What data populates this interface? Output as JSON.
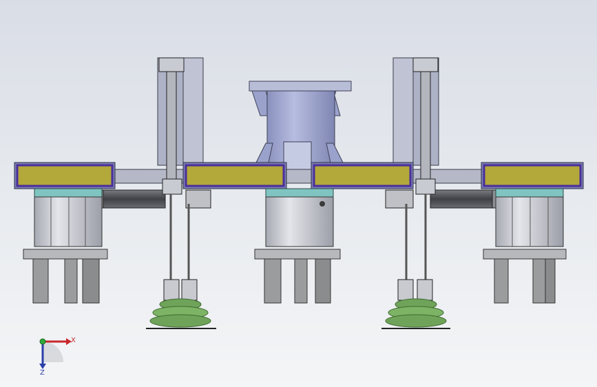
{
  "viewport": {
    "background_top": "#d9dde6",
    "background_bottom": "#f4f5f7"
  },
  "triad": {
    "x_label": "X",
    "z_label": "Z",
    "x_color": "#c8262c",
    "z_color": "#2a3fa8",
    "origin_color": "#2faa3a"
  },
  "colors": {
    "plate_fill": "#b3a83a",
    "plate_border": "#4a2f9a",
    "frame_gray": "#a9aebf",
    "frame_dark": "#4a4d5c",
    "column_blue": "#9aa2cc",
    "gripper_body": "#c8cad2",
    "gripper_cap": "#7fc4c0",
    "finger_gray": "#9a9c9e",
    "cylinder_dark": "#5a5c60",
    "suction_green": "#6fa35a",
    "suction_dark": "#3f6a30"
  }
}
